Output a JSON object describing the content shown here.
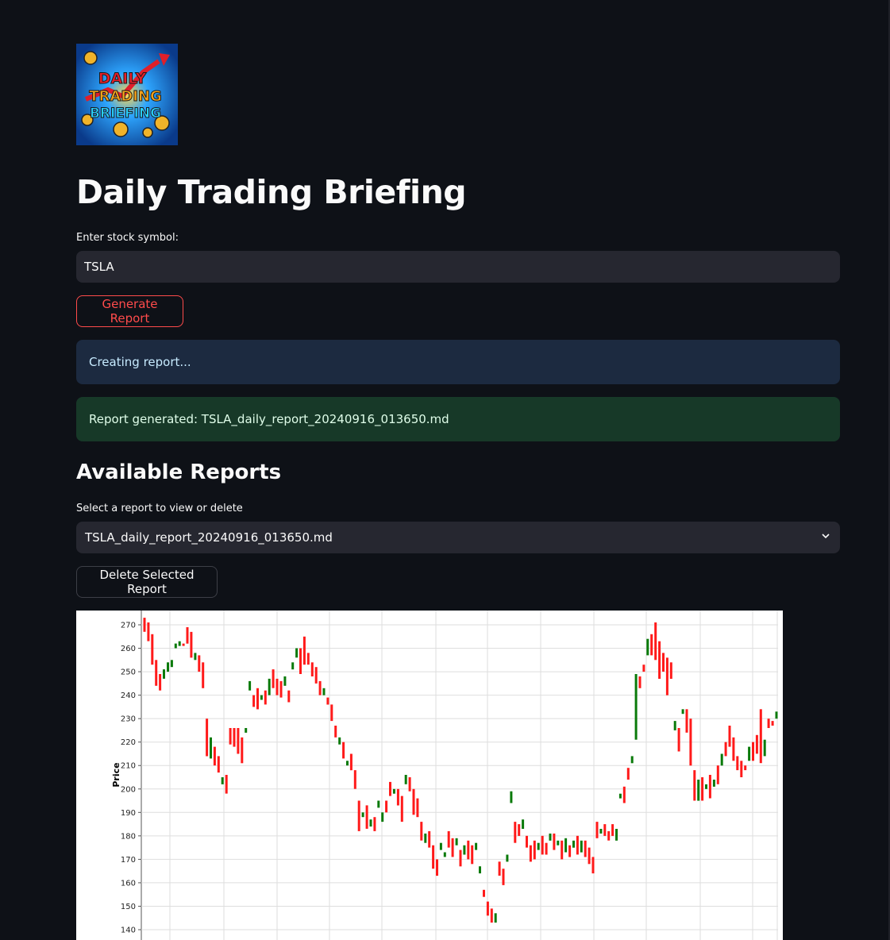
{
  "app": {
    "title": "Daily Trading Briefing",
    "logo_text": [
      "DAILY",
      "TRADING",
      "BRIEFING"
    ]
  },
  "form": {
    "symbol_label": "Enter stock symbol:",
    "symbol_value": "TSLA",
    "generate_label": "Generate Report"
  },
  "alerts": {
    "info": "Creating report...",
    "success": "Report generated: TSLA_daily_report_20240916_013650.md"
  },
  "reports": {
    "heading": "Available Reports",
    "select_label": "Select a report to view or delete",
    "selected": "TSLA_daily_report_20240916_013650.md",
    "delete_label": "Delete Selected Report"
  },
  "colors": {
    "background": "#0e1117",
    "primary": "#ff4b4b",
    "up": "#0a7a0a",
    "down": "#ff1a1a"
  },
  "chart_data": {
    "type": "candlestick",
    "ylabel": "Price",
    "ylim": [
      138,
      274
    ],
    "yticks": [
      140,
      150,
      160,
      170,
      180,
      190,
      200,
      210,
      220,
      230,
      240,
      250,
      260,
      270
    ],
    "grid": true,
    "candles": [
      [
        "d",
        273,
        267
      ],
      [
        "d",
        271,
        263
      ],
      [
        "d",
        266,
        253
      ],
      [
        "d",
        255,
        244
      ],
      [
        "d",
        249,
        242
      ],
      [
        "u",
        247,
        251
      ],
      [
        "u",
        250,
        254
      ],
      [
        "u",
        252,
        255
      ],
      [
        "u",
        260,
        262
      ],
      [
        "u",
        261,
        263
      ],
      [
        "d",
        262,
        261
      ],
      [
        "d",
        269,
        262
      ],
      [
        "d",
        267,
        256
      ],
      [
        "u",
        255,
        258
      ],
      [
        "d",
        257,
        250
      ],
      [
        "d",
        254,
        243
      ],
      [
        "d",
        230,
        214
      ],
      [
        "u",
        213,
        222
      ],
      [
        "d",
        218,
        210
      ],
      [
        "d",
        214,
        207
      ],
      [
        "u",
        202,
        205
      ],
      [
        "d",
        206,
        198
      ],
      [
        "d",
        226,
        219
      ],
      [
        "d",
        226,
        218
      ],
      [
        "d",
        226,
        215
      ],
      [
        "d",
        222,
        211
      ],
      [
        "u",
        224,
        226
      ],
      [
        "u",
        242,
        246
      ],
      [
        "d",
        240,
        235
      ],
      [
        "d",
        243,
        234
      ],
      [
        "u",
        238,
        240
      ],
      [
        "d",
        242,
        236
      ],
      [
        "u",
        240,
        247
      ],
      [
        "d",
        251,
        243
      ],
      [
        "d",
        247,
        240
      ],
      [
        "d",
        246,
        239
      ],
      [
        "u",
        244,
        248
      ],
      [
        "d",
        242,
        237
      ],
      [
        "u",
        251,
        254
      ],
      [
        "u",
        256,
        260
      ],
      [
        "d",
        260,
        249
      ],
      [
        "d",
        265,
        253
      ],
      [
        "d",
        258,
        253
      ],
      [
        "d",
        254,
        248
      ],
      [
        "d",
        252,
        245
      ],
      [
        "d",
        246,
        240
      ],
      [
        "u",
        240,
        243
      ],
      [
        "d",
        239,
        236
      ],
      [
        "d",
        236,
        229
      ],
      [
        "d",
        227,
        222
      ],
      [
        "u",
        219,
        222
      ],
      [
        "d",
        220,
        213
      ],
      [
        "u",
        210,
        212
      ],
      [
        "d",
        215,
        208
      ],
      [
        "d",
        208,
        200
      ],
      [
        "d",
        195,
        182
      ],
      [
        "u",
        188,
        190
      ],
      [
        "d",
        193,
        183
      ],
      [
        "u",
        184,
        187
      ],
      [
        "d",
        188,
        182
      ],
      [
        "u",
        192,
        195
      ],
      [
        "u",
        186,
        190
      ],
      [
        "d",
        195,
        190
      ],
      [
        "d",
        203,
        197
      ],
      [
        "u",
        198,
        200
      ],
      [
        "d",
        200,
        193
      ],
      [
        "d",
        197,
        186
      ],
      [
        "u",
        202,
        206
      ],
      [
        "d",
        205,
        199
      ],
      [
        "d",
        200,
        189
      ],
      [
        "d",
        196,
        188
      ],
      [
        "d",
        186,
        178
      ],
      [
        "u",
        177,
        181
      ],
      [
        "d",
        182,
        175
      ],
      [
        "d",
        176,
        166
      ],
      [
        "d",
        170,
        163
      ],
      [
        "u",
        174,
        177
      ],
      [
        "u",
        171,
        173
      ],
      [
        "d",
        182,
        175
      ],
      [
        "d",
        179,
        171
      ],
      [
        "u",
        176,
        179
      ],
      [
        "d",
        174,
        167
      ],
      [
        "u",
        172,
        176
      ],
      [
        "d",
        178,
        170
      ],
      [
        "d",
        176,
        168
      ],
      [
        "u",
        174,
        177
      ],
      [
        "u",
        164,
        167
      ],
      [
        "d",
        157,
        154
      ],
      [
        "d",
        152,
        146
      ],
      [
        "d",
        149,
        143
      ],
      [
        "u",
        143,
        147
      ],
      [
        "d",
        169,
        163
      ],
      [
        "d",
        166,
        159
      ],
      [
        "u",
        169,
        172
      ],
      [
        "u",
        194,
        199
      ],
      [
        "d",
        186,
        177
      ],
      [
        "d",
        185,
        180
      ],
      [
        "u",
        183,
        187
      ],
      [
        "d",
        180,
        175
      ],
      [
        "d",
        176,
        169
      ],
      [
        "d",
        178,
        170
      ],
      [
        "u",
        174,
        177
      ],
      [
        "d",
        180,
        172
      ],
      [
        "d",
        177,
        172
      ],
      [
        "u",
        178,
        181
      ],
      [
        "d",
        181,
        174
      ],
      [
        "u",
        176,
        178
      ],
      [
        "d",
        178,
        170
      ],
      [
        "u",
        173,
        179
      ],
      [
        "d",
        176,
        171
      ],
      [
        "u",
        175,
        178
      ],
      [
        "d",
        180,
        172
      ],
      [
        "u",
        173,
        178
      ],
      [
        "d",
        178,
        171
      ],
      [
        "d",
        175,
        168
      ],
      [
        "d",
        171,
        164
      ],
      [
        "d",
        186,
        179
      ],
      [
        "u",
        181,
        183
      ],
      [
        "d",
        185,
        180
      ],
      [
        "d",
        182,
        178
      ],
      [
        "d",
        185,
        180
      ],
      [
        "u",
        178,
        183
      ],
      [
        "u",
        196,
        198
      ],
      [
        "d",
        201,
        194
      ],
      [
        "d",
        209,
        204
      ],
      [
        "u",
        211,
        214
      ],
      [
        "u",
        221,
        249
      ],
      [
        "d",
        248,
        243
      ],
      [
        "d",
        253,
        250
      ],
      [
        "u",
        257,
        264
      ],
      [
        "d",
        266,
        257
      ],
      [
        "d",
        271,
        255
      ],
      [
        "d",
        263,
        247
      ],
      [
        "d",
        258,
        250
      ],
      [
        "d",
        256,
        240
      ],
      [
        "d",
        254,
        247
      ],
      [
        "u",
        225,
        229
      ],
      [
        "d",
        226,
        216
      ],
      [
        "u",
        232,
        234
      ],
      [
        "d",
        234,
        224
      ],
      [
        "d",
        230,
        210
      ],
      [
        "d",
        208,
        195
      ],
      [
        "u",
        195,
        204
      ],
      [
        "d",
        205,
        195
      ],
      [
        "u",
        200,
        202
      ],
      [
        "d",
        206,
        196
      ],
      [
        "u",
        201,
        204
      ],
      [
        "d",
        210,
        202
      ],
      [
        "u",
        210,
        215
      ],
      [
        "d",
        220,
        214
      ],
      [
        "d",
        227,
        218
      ],
      [
        "d",
        222,
        212
      ],
      [
        "d",
        214,
        208
      ],
      [
        "d",
        212,
        205
      ],
      [
        "d",
        210,
        208
      ],
      [
        "u",
        212,
        218
      ],
      [
        "d",
        220,
        212
      ],
      [
        "d",
        223,
        215
      ],
      [
        "d",
        234,
        211
      ],
      [
        "u",
        214,
        221
      ],
      [
        "d",
        230,
        226
      ],
      [
        "d",
        229,
        227
      ],
      [
        "u",
        230,
        233
      ]
    ]
  }
}
